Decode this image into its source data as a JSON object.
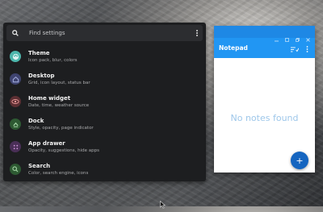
{
  "search": {
    "placeholder": "Find settings"
  },
  "settings_items": [
    {
      "title": "Theme",
      "subtitle": "Icon pack, blur, colors",
      "icon": "palette-icon",
      "color": "#4db6ac"
    },
    {
      "title": "Desktop",
      "subtitle": "Grid, icon layout, status bar",
      "icon": "home-icon",
      "color": "#7986cb"
    },
    {
      "title": "Home widget",
      "subtitle": "Date, time, weather source",
      "icon": "eye-icon",
      "color": "#e57373"
    },
    {
      "title": "Dock",
      "subtitle": "Style, opacity, page indicator",
      "icon": "dock-icon",
      "color": "#66bb6a"
    },
    {
      "title": "App drawer",
      "subtitle": "Opacity, suggestions, hide apps",
      "icon": "grid-icon",
      "color": "#ba68c8"
    },
    {
      "title": "Search",
      "subtitle": "Color, search engine, icons",
      "icon": "search-icon",
      "color": "#66bb6a"
    }
  ],
  "notepad": {
    "title": "Notepad",
    "empty_text": "No notes found",
    "fab_label": "+",
    "accent": "#2196f3"
  }
}
